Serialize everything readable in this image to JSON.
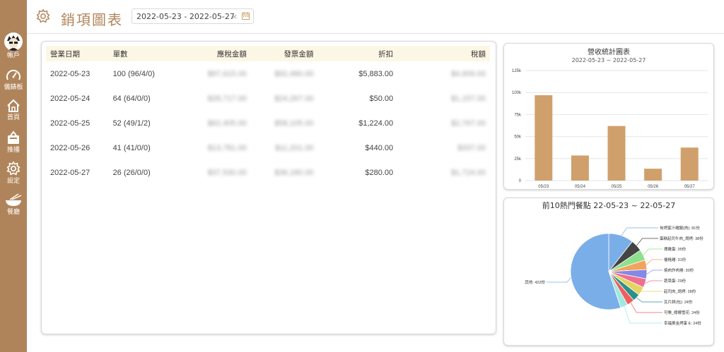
{
  "sidebar": {
    "items": [
      {
        "label": "帳戶",
        "icon": "avatar-icon"
      },
      {
        "label": "儀錶板",
        "icon": "gauge-icon"
      },
      {
        "label": "首頁",
        "icon": "home-icon"
      },
      {
        "label": "推播",
        "icon": "broadcast-icon"
      },
      {
        "label": "設定",
        "icon": "gear-icon"
      },
      {
        "label": "餐廳",
        "icon": "bowl-icon"
      }
    ]
  },
  "header": {
    "title": "銷項圖表",
    "date_range": "2022-05-23 - 2022-05-27",
    "clear": "×",
    "icon": "gear-icon"
  },
  "table": {
    "headers": [
      "營業日期",
      "單數",
      "應稅金額",
      "發票金額",
      "折扣",
      "稅額"
    ],
    "rows": [
      {
        "date": "2022-05-23",
        "orders": "100 (96/4/0)",
        "taxable": "$97,615.00",
        "invoice": "$92,480.00",
        "discount": "$5,883.00",
        "tax": "$4,609.00"
      },
      {
        "date": "2022-05-24",
        "orders": "64 (64/0/0)",
        "taxable": "$28,717.00",
        "invoice": "$24,267.00",
        "discount": "$50.00",
        "tax": "$1,157.00"
      },
      {
        "date": "2022-05-25",
        "orders": "52 (49/1/2)",
        "taxable": "$62,405.00",
        "invoice": "$58,105.00",
        "discount": "$1,224.00",
        "tax": "$2,767.00"
      },
      {
        "date": "2022-05-26",
        "orders": "41 (41/0/0)",
        "taxable": "$13,781.00",
        "invoice": "$11,201.00",
        "discount": "$440.00",
        "tax": "$337.00"
      },
      {
        "date": "2022-05-27",
        "orders": "26 (26/0/0)",
        "taxable": "$37,530.00",
        "invoice": "$36,180.00",
        "discount": "$280.00",
        "tax": "$1,724.00"
      }
    ]
  },
  "colors": {
    "accent": "#b0845a",
    "bar": "#d0a06c",
    "header_row": "#fcf6e5"
  },
  "chart_data": [
    {
      "type": "bar",
      "title": "營收統計圖表",
      "subtitle": "2022-05-23 ~ 2022-05-27",
      "categories": [
        "05/23",
        "05/24",
        "05/25",
        "05/26",
        "05/27"
      ],
      "values": [
        97000,
        28500,
        62000,
        13500,
        37500
      ],
      "yticks": [
        "0",
        "25k",
        "50k",
        "75k",
        "100k",
        "125k"
      ],
      "ylim": [
        0,
        125000
      ],
      "grid": true
    },
    {
      "type": "pie",
      "title": "前10熱門餐點 22-05-23 ~ 22-05-27",
      "slices": [
        {
          "label": "炭烤蜜汁雞腿(肉): 81份",
          "value": 81,
          "color": "#7aaee8"
        },
        {
          "label": "蛋糕起司牛肉_焗烤: 38份",
          "value": 38,
          "color": "#444444"
        },
        {
          "label": "燻雞蛋: 35份",
          "value": 35,
          "color": "#8ee08c"
        },
        {
          "label": "優格雞: 31份",
          "value": 31,
          "color": "#f2a35e"
        },
        {
          "label": "燒肉炸肉捲: 30份",
          "value": 30,
          "color": "#8688e6"
        },
        {
          "label": "蔬菜蛋: 29份",
          "value": 29,
          "color": "#ee6f90"
        },
        {
          "label": "起司肉_焗烤: 28份",
          "value": 28,
          "color": "#e4d461"
        },
        {
          "label": "瓦片餅(包): 24份",
          "value": 24,
          "color": "#2c8f8a"
        },
        {
          "label": "可樂_檸檬雪花: 24份",
          "value": 24,
          "color": "#ef5d5d"
        },
        {
          "label": "幸福黃金烤蛋 E: 24份",
          "value": 24,
          "color": "#9ee8e0"
        },
        {
          "label": "其他: 422份",
          "value": 422,
          "color": "#7aaee8"
        }
      ]
    }
  ]
}
